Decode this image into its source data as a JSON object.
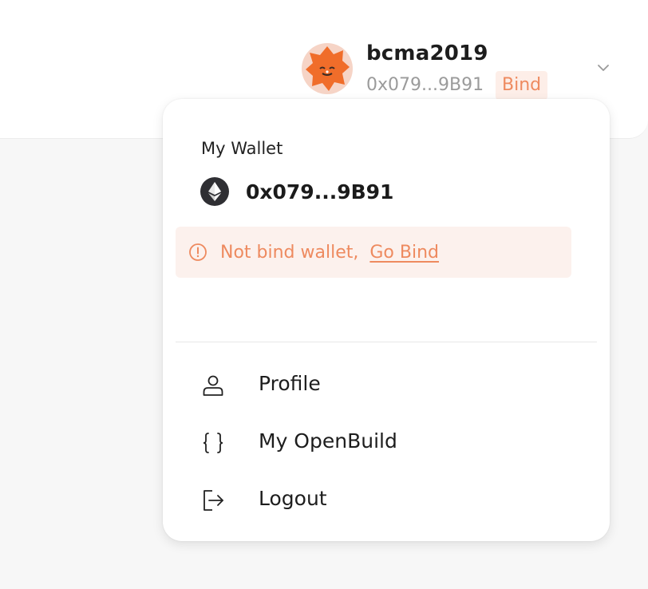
{
  "header": {
    "username": "bcma2019",
    "short_address": "0x079...9B91",
    "bind_label": "Bind"
  },
  "wallet": {
    "section_label": "My Wallet",
    "address": "0x079...9B91",
    "alert_text": "Not bind wallet,",
    "alert_link": "Go Bind"
  },
  "menu": {
    "items": [
      {
        "label": "Profile",
        "icon": "user-icon"
      },
      {
        "label": "My OpenBuild",
        "icon": "braces-icon"
      },
      {
        "label": "Logout",
        "icon": "logout-icon"
      }
    ]
  },
  "colors": {
    "accent": "#ee8a5f",
    "accent_bg": "#fcf1ed",
    "text_primary": "#1d1d1d",
    "text_muted": "#9b9b9b"
  }
}
